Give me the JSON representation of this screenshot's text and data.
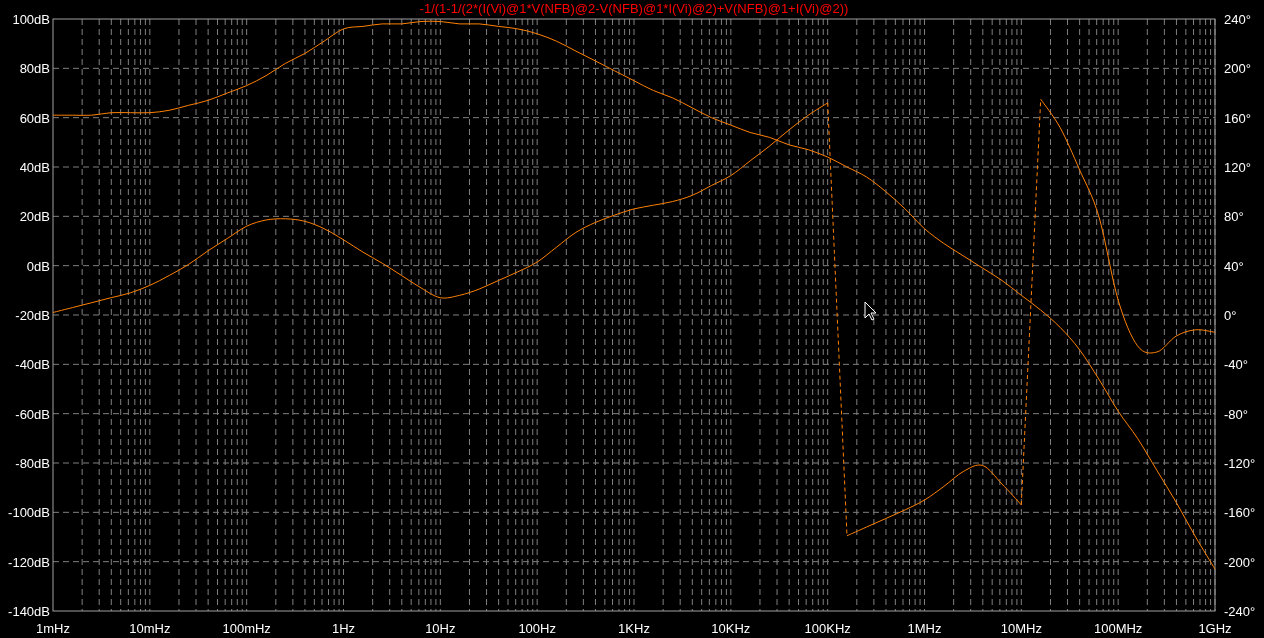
{
  "plot": {
    "chart_data": {
      "type": "line",
      "title": "-1/(1-1/(2*(I(Vi)@1*V(NFB)@2-V(NFB)@1*I(Vi)@2)+V(NFB)@1+I(Vi)@2))",
      "categories": [
        "1mHz",
        null,
        null,
        null,
        null,
        "10mHz",
        null,
        null,
        null,
        null,
        "100mHz",
        null,
        null,
        null,
        null,
        "1Hz",
        null,
        null,
        null,
        null,
        "10Hz",
        null,
        null,
        null,
        null,
        "100Hz",
        null,
        null,
        null,
        null,
        "1KHz",
        null,
        null,
        null,
        null,
        "10KHz",
        null,
        null,
        null,
        null,
        "100KHz",
        null,
        null,
        null,
        null,
        "1MHz",
        null,
        null,
        null,
        null,
        "10MHz",
        null,
        null,
        null,
        null,
        "100MHz",
        null,
        null,
        null,
        null,
        "1GHz"
      ],
      "grid": true,
      "ylim": [
        -140,
        100
      ],
      "yticks": [
        {
          "value": 100,
          "label": "100dB"
        },
        {
          "value": 80,
          "label": "80dB"
        },
        {
          "value": 60,
          "label": "60dB"
        },
        {
          "value": 40,
          "label": "40dB"
        },
        {
          "value": 20,
          "label": "20dB"
        },
        {
          "value": 0,
          "label": "0dB"
        },
        {
          "value": -20,
          "label": "-20dB"
        },
        {
          "value": -40,
          "label": "-40dB"
        },
        {
          "value": -60,
          "label": "-60dB"
        },
        {
          "value": -80,
          "label": "-80dB"
        },
        {
          "value": -100,
          "label": "-100dB"
        },
        {
          "value": -120,
          "label": "-120dB"
        },
        {
          "value": -140,
          "label": "-140dB"
        }
      ],
      "y2lim": [
        -240,
        240
      ],
      "y2ticks": [
        {
          "value": 240,
          "label": "240°"
        },
        {
          "value": 200,
          "label": "200°"
        },
        {
          "value": 160,
          "label": "160°"
        },
        {
          "value": 120,
          "label": "120°"
        },
        {
          "value": 80,
          "label": "80°"
        },
        {
          "value": 40,
          "label": "40°"
        },
        {
          "value": 0,
          "label": "0°"
        },
        {
          "value": -40,
          "label": "-40°"
        },
        {
          "value": -80,
          "label": "-80°"
        },
        {
          "value": -120,
          "label": "-120°"
        },
        {
          "value": -160,
          "label": "-160°"
        },
        {
          "value": -200,
          "label": "-200°"
        },
        {
          "value": -240,
          "label": "-240°"
        }
      ],
      "series": [
        {
          "color": "#ff8000",
          "values": [
            61,
            61,
            61,
            62,
            62,
            62,
            63,
            65,
            67,
            70,
            73,
            77,
            82,
            86,
            91,
            96,
            97,
            98,
            98,
            99,
            99,
            98,
            98,
            97,
            96,
            94,
            91,
            87,
            83,
            79,
            75,
            71,
            68,
            64,
            60,
            57,
            54,
            52,
            49,
            47,
            44,
            40,
            36,
            30,
            23,
            15,
            9,
            4,
            -1,
            -6,
            -12,
            -18,
            -25,
            -34,
            -46,
            -59,
            -70,
            -83,
            -96,
            -110,
            -123
          ]
        },
        {
          "axis": "y2",
          "color": "#ff8000",
          "values": [
            2,
            6,
            10,
            14,
            18,
            24,
            32,
            41,
            52,
            62,
            72,
            77,
            78,
            76,
            70,
            61,
            51,
            42,
            32,
            22,
            14,
            16,
            21,
            28,
            35,
            43,
            55,
            67,
            75,
            81,
            86,
            89,
            92,
            97,
            105,
            113,
            125,
            137,
            150,
            162,
            172,
            -179,
            -172,
            -165,
            -158,
            -150,
            -139,
            -127,
            -122,
            -137,
            -154,
            175,
            152,
            118,
            80,
            12,
            -25,
            -30,
            -17,
            -12,
            -14
          ]
        }
      ]
    }
  }
}
